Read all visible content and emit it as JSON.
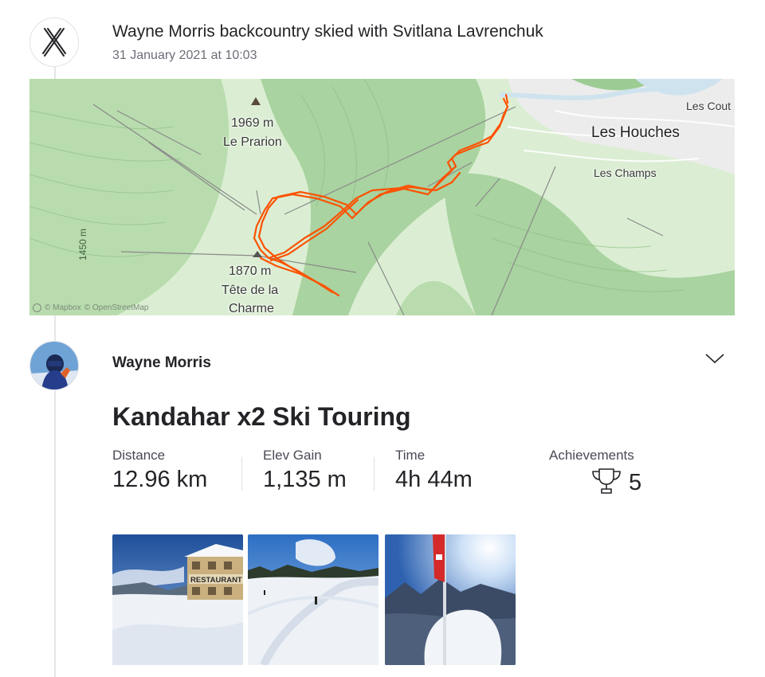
{
  "header": {
    "title": "Wayne Morris backcountry skied with Svitlana Lavrenchuk",
    "date": "31 January 2021 at 10:03",
    "sport_icon": "crossed-skis-icon"
  },
  "map": {
    "labels": {
      "peak1_elev": "1969 m",
      "peak1_name": "Le Prarion",
      "peak2_elev": "1870 m",
      "peak2_name_line1": "Tête de la",
      "peak2_name_line2": "Charme",
      "contour_elev": "1450 m",
      "town1": "Les Houches",
      "town2": "Les Champs",
      "town3": "Les Cout"
    },
    "attribution_mapbox": "© Mapbox",
    "attribution_osm": "© OpenStreetMap",
    "route_color": "#fc5200",
    "colors": {
      "forest": "#a9d3a0",
      "meadow": "#dbeed3",
      "town": "#ececec",
      "river": "#cfe3ef"
    }
  },
  "athlete": {
    "name": "Wayne Morris",
    "avatar_icon": "avatar-photo",
    "menu_icon": "chevron-down-icon"
  },
  "activity": {
    "title": "Kandahar x2 Ski Touring",
    "stats": {
      "distance": {
        "label": "Distance",
        "value": "12.96 km"
      },
      "elev_gain": {
        "label": "Elev Gain",
        "value": "1,135 m"
      },
      "time": {
        "label": "Time",
        "value": "4h 44m"
      },
      "achievements": {
        "label": "Achievements",
        "value": "5",
        "icon": "trophy-icon"
      }
    }
  },
  "photos": [
    {
      "name": "photo-restaurant",
      "sign_text": "RESTAURANT"
    },
    {
      "name": "photo-ski-trail"
    },
    {
      "name": "photo-flag-view"
    }
  ]
}
